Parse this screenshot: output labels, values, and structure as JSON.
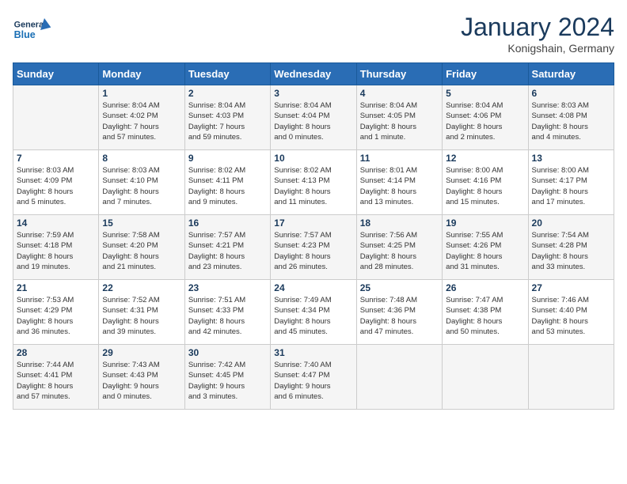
{
  "header": {
    "logo_line1": "General",
    "logo_line2": "Blue",
    "title": "January 2024",
    "location": "Konigshain, Germany"
  },
  "columns": [
    "Sunday",
    "Monday",
    "Tuesday",
    "Wednesday",
    "Thursday",
    "Friday",
    "Saturday"
  ],
  "weeks": [
    [
      {
        "day": "",
        "info": ""
      },
      {
        "day": "1",
        "info": "Sunrise: 8:04 AM\nSunset: 4:02 PM\nDaylight: 7 hours\nand 57 minutes."
      },
      {
        "day": "2",
        "info": "Sunrise: 8:04 AM\nSunset: 4:03 PM\nDaylight: 7 hours\nand 59 minutes."
      },
      {
        "day": "3",
        "info": "Sunrise: 8:04 AM\nSunset: 4:04 PM\nDaylight: 8 hours\nand 0 minutes."
      },
      {
        "day": "4",
        "info": "Sunrise: 8:04 AM\nSunset: 4:05 PM\nDaylight: 8 hours\nand 1 minute."
      },
      {
        "day": "5",
        "info": "Sunrise: 8:04 AM\nSunset: 4:06 PM\nDaylight: 8 hours\nand 2 minutes."
      },
      {
        "day": "6",
        "info": "Sunrise: 8:03 AM\nSunset: 4:08 PM\nDaylight: 8 hours\nand 4 minutes."
      }
    ],
    [
      {
        "day": "7",
        "info": "Sunrise: 8:03 AM\nSunset: 4:09 PM\nDaylight: 8 hours\nand 5 minutes."
      },
      {
        "day": "8",
        "info": "Sunrise: 8:03 AM\nSunset: 4:10 PM\nDaylight: 8 hours\nand 7 minutes."
      },
      {
        "day": "9",
        "info": "Sunrise: 8:02 AM\nSunset: 4:11 PM\nDaylight: 8 hours\nand 9 minutes."
      },
      {
        "day": "10",
        "info": "Sunrise: 8:02 AM\nSunset: 4:13 PM\nDaylight: 8 hours\nand 11 minutes."
      },
      {
        "day": "11",
        "info": "Sunrise: 8:01 AM\nSunset: 4:14 PM\nDaylight: 8 hours\nand 13 minutes."
      },
      {
        "day": "12",
        "info": "Sunrise: 8:00 AM\nSunset: 4:16 PM\nDaylight: 8 hours\nand 15 minutes."
      },
      {
        "day": "13",
        "info": "Sunrise: 8:00 AM\nSunset: 4:17 PM\nDaylight: 8 hours\nand 17 minutes."
      }
    ],
    [
      {
        "day": "14",
        "info": "Sunrise: 7:59 AM\nSunset: 4:18 PM\nDaylight: 8 hours\nand 19 minutes."
      },
      {
        "day": "15",
        "info": "Sunrise: 7:58 AM\nSunset: 4:20 PM\nDaylight: 8 hours\nand 21 minutes."
      },
      {
        "day": "16",
        "info": "Sunrise: 7:57 AM\nSunset: 4:21 PM\nDaylight: 8 hours\nand 23 minutes."
      },
      {
        "day": "17",
        "info": "Sunrise: 7:57 AM\nSunset: 4:23 PM\nDaylight: 8 hours\nand 26 minutes."
      },
      {
        "day": "18",
        "info": "Sunrise: 7:56 AM\nSunset: 4:25 PM\nDaylight: 8 hours\nand 28 minutes."
      },
      {
        "day": "19",
        "info": "Sunrise: 7:55 AM\nSunset: 4:26 PM\nDaylight: 8 hours\nand 31 minutes."
      },
      {
        "day": "20",
        "info": "Sunrise: 7:54 AM\nSunset: 4:28 PM\nDaylight: 8 hours\nand 33 minutes."
      }
    ],
    [
      {
        "day": "21",
        "info": "Sunrise: 7:53 AM\nSunset: 4:29 PM\nDaylight: 8 hours\nand 36 minutes."
      },
      {
        "day": "22",
        "info": "Sunrise: 7:52 AM\nSunset: 4:31 PM\nDaylight: 8 hours\nand 39 minutes."
      },
      {
        "day": "23",
        "info": "Sunrise: 7:51 AM\nSunset: 4:33 PM\nDaylight: 8 hours\nand 42 minutes."
      },
      {
        "day": "24",
        "info": "Sunrise: 7:49 AM\nSunset: 4:34 PM\nDaylight: 8 hours\nand 45 minutes."
      },
      {
        "day": "25",
        "info": "Sunrise: 7:48 AM\nSunset: 4:36 PM\nDaylight: 8 hours\nand 47 minutes."
      },
      {
        "day": "26",
        "info": "Sunrise: 7:47 AM\nSunset: 4:38 PM\nDaylight: 8 hours\nand 50 minutes."
      },
      {
        "day": "27",
        "info": "Sunrise: 7:46 AM\nSunset: 4:40 PM\nDaylight: 8 hours\nand 53 minutes."
      }
    ],
    [
      {
        "day": "28",
        "info": "Sunrise: 7:44 AM\nSunset: 4:41 PM\nDaylight: 8 hours\nand 57 minutes."
      },
      {
        "day": "29",
        "info": "Sunrise: 7:43 AM\nSunset: 4:43 PM\nDaylight: 9 hours\nand 0 minutes."
      },
      {
        "day": "30",
        "info": "Sunrise: 7:42 AM\nSunset: 4:45 PM\nDaylight: 9 hours\nand 3 minutes."
      },
      {
        "day": "31",
        "info": "Sunrise: 7:40 AM\nSunset: 4:47 PM\nDaylight: 9 hours\nand 6 minutes."
      },
      {
        "day": "",
        "info": ""
      },
      {
        "day": "",
        "info": ""
      },
      {
        "day": "",
        "info": ""
      }
    ]
  ]
}
